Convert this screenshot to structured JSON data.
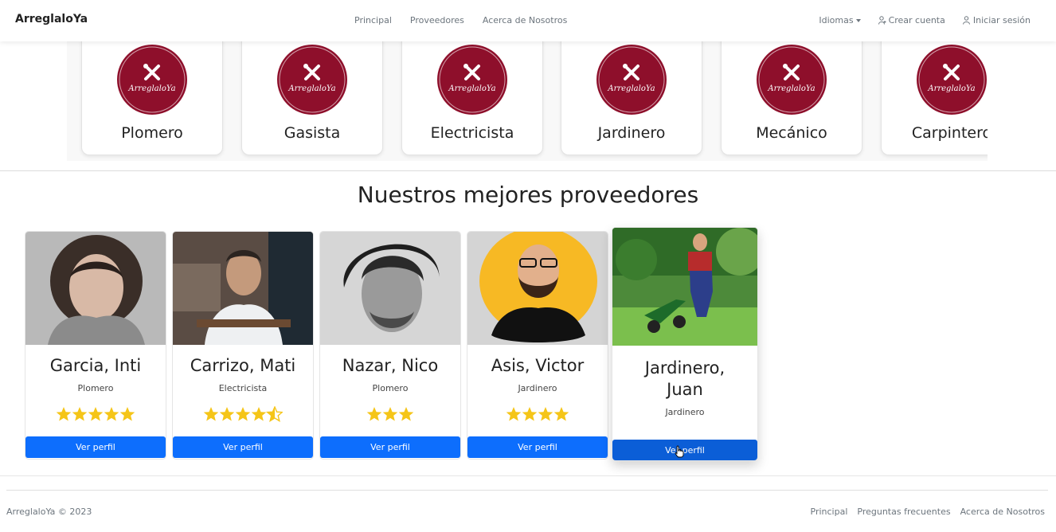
{
  "navbar": {
    "brand": "ArreglaloYa",
    "links": [
      "Principal",
      "Proveedores",
      "Acerca de Nosotros"
    ],
    "languages_label": "Idiomas",
    "signup_label": "Crear cuenta",
    "login_label": "Iniciar sesión"
  },
  "categories": {
    "logo_text": "ArreglaloYa",
    "items": [
      "Plomero",
      "Gasista",
      "Electricista",
      "Jardinero",
      "Mecánico",
      "Carpintero"
    ]
  },
  "providers": {
    "title": "Nuestros mejores proveedores",
    "button_label": "Ver perfil",
    "items": [
      {
        "name": "Garcia, Inti",
        "trade": "Plomero",
        "rating": 5
      },
      {
        "name": "Carrizo, Mati",
        "trade": "Electricista",
        "rating": 4.5
      },
      {
        "name": "Nazar, Nico",
        "trade": "Plomero",
        "rating": 3
      },
      {
        "name": "Asis, Victor",
        "trade": "Jardinero",
        "rating": 4
      },
      {
        "name_line1": "Jardinero,",
        "name_line2": "Juan",
        "trade": "Jardinero"
      }
    ]
  },
  "footer": {
    "copyright": "ArreglaloYa © 2023",
    "links": [
      "Principal",
      "Preguntas frecuentes",
      "Acerca de Nosotros"
    ]
  },
  "colors": {
    "primary": "#0d6efd",
    "logo_bg": "#8e0f2b",
    "star": "#f5c518"
  }
}
